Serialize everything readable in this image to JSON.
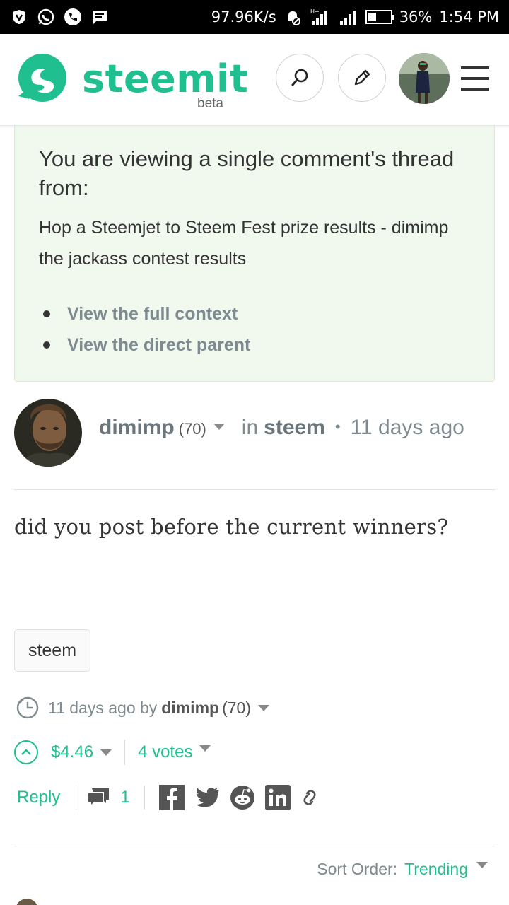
{
  "status_bar": {
    "net_speed": "97.96K/s",
    "battery_percent": "36%",
    "battery_level": 0.36,
    "time": "1:54 PM",
    "icons": [
      "shield-app-icon",
      "whatsapp-icon",
      "phone-call-icon",
      "message-icon",
      "alarm-off-icon",
      "signal-icon",
      "signal-icon",
      "battery-icon"
    ]
  },
  "header": {
    "logo_text": "steemit",
    "logo_sub": "beta",
    "brand_color": "#1fbf8f"
  },
  "thread_notice": {
    "title": "You are viewing a single comment's thread from:",
    "post_title": "Hop a Steemjet to Steem Fest prize results - dimimp the jackass contest results",
    "links": [
      "View the full context",
      "View the direct parent"
    ]
  },
  "comment": {
    "author": "dimimp",
    "reputation": "(70)",
    "in_label": "in",
    "category": "steem",
    "age": "11 days ago",
    "body": "did you post before the current winners?",
    "tag": "steem",
    "footer": {
      "time": "11 days ago by",
      "author": "dimimp",
      "reputation": "(70)"
    },
    "payout": "$4.46",
    "votes": "4 votes",
    "reply_label": "Reply",
    "reply_count": "1"
  },
  "sort": {
    "label": "Sort Order:",
    "value": "Trending"
  }
}
